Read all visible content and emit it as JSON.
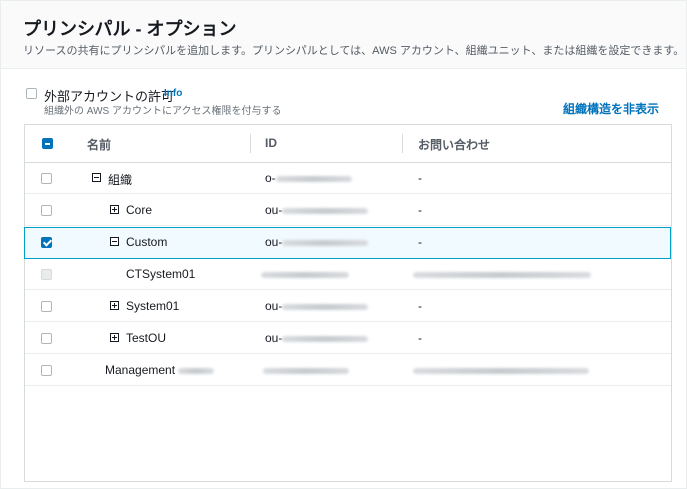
{
  "header": {
    "title": "プリンシパル - オプション",
    "description": "リソースの共有にプリンシパルを追加します。プリンシパルとしては、AWS アカウント、組織ユニット、または組織を設定できます。"
  },
  "external_access": {
    "label": "外部アカウントの許可",
    "info_link": "Info",
    "description": "組織外の AWS アカウントにアクセス権限を付与する",
    "checked": false
  },
  "hide_org_structure_link": "組織構造を非表示",
  "table": {
    "columns": [
      "名前",
      "ID",
      "お問い合わせ"
    ],
    "rows": [
      {
        "name": "組織",
        "id_prefix": "o-",
        "contact": "-",
        "checked": false,
        "expander": "minus"
      },
      {
        "name": "Core",
        "id_prefix": "ou-",
        "contact": "-",
        "checked": false,
        "expander": "plus"
      },
      {
        "name": "Custom",
        "id_prefix": "ou-",
        "contact": "-",
        "checked": true,
        "expander": "minus"
      },
      {
        "name": "CTSystem01",
        "id_prefix": "",
        "contact": "",
        "checked": false,
        "disabled": true
      },
      {
        "name": "System01",
        "id_prefix": "ou-",
        "contact": "-",
        "checked": false,
        "expander": "plus"
      },
      {
        "name": "TestOU",
        "id_prefix": "ou-",
        "contact": "-",
        "checked": false,
        "expander": "plus"
      },
      {
        "name": "Management",
        "id_prefix": "",
        "contact": "",
        "checked": false
      }
    ]
  },
  "colors": {
    "accent": "#0073bb",
    "selected_row_border": "#00a1c9",
    "selected_row_bg": "#f1faff"
  }
}
